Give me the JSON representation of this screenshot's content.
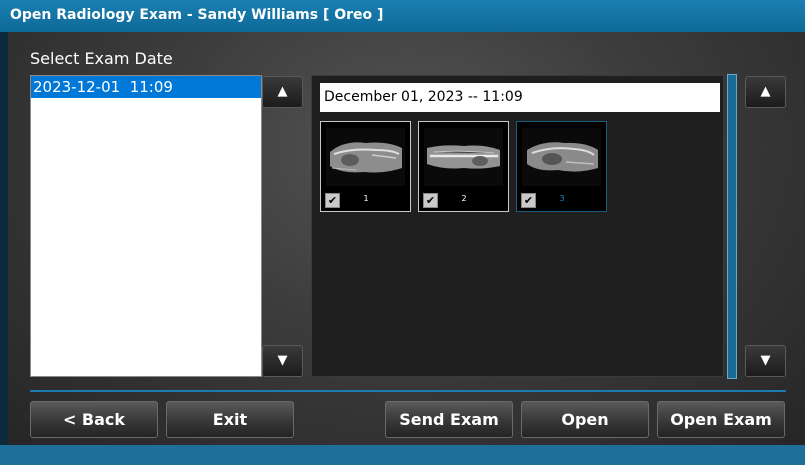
{
  "window": {
    "title": "Open Radiology Exam - Sandy Williams [ Oreo ]"
  },
  "exam_dates": {
    "label": "Select Exam Date",
    "items": [
      {
        "label": "2023-12-01  11:09",
        "selected": true
      }
    ]
  },
  "scroll": {
    "up_icon": "triangle-up",
    "down_icon": "triangle-down",
    "up_glyph": "▲",
    "down_glyph": "▼"
  },
  "exam": {
    "date_display": "December 01, 2023 -- 11:09",
    "images": [
      {
        "number": "1",
        "checked": true,
        "check_glyph": "✔"
      },
      {
        "number": "2",
        "checked": true,
        "check_glyph": "✔"
      },
      {
        "number": "3",
        "checked": true,
        "check_glyph": "✔",
        "selected": true
      }
    ]
  },
  "buttons": {
    "back": "< Back",
    "exit": "Exit",
    "send_exam": "Send Exam",
    "open": "Open",
    "open_exam": "Open Exam"
  },
  "colors": {
    "title_bar": "#1a7fb2",
    "accent": "#1b7ab0",
    "selection": "#0078d7"
  }
}
